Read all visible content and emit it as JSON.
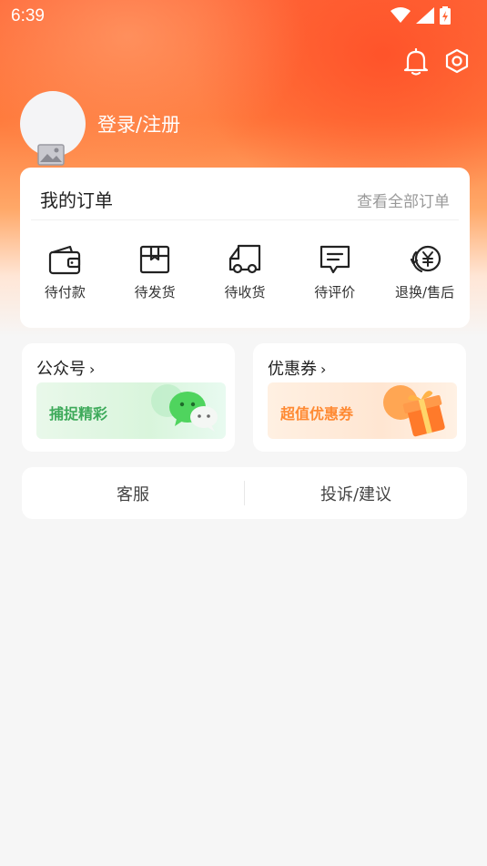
{
  "status_bar": {
    "time": "6:39"
  },
  "user": {
    "login_label": "登录/注册"
  },
  "orders": {
    "title": "我的订单",
    "view_all": "查看全部订单",
    "items": [
      {
        "label": "待付款",
        "icon": "wallet-icon"
      },
      {
        "label": "待发货",
        "icon": "package-icon"
      },
      {
        "label": "待收货",
        "icon": "truck-icon"
      },
      {
        "label": "待评价",
        "icon": "comment-icon"
      },
      {
        "label": "退换/售后",
        "icon": "yen-refund-icon"
      }
    ]
  },
  "promos": {
    "official_account": {
      "title": "公众号",
      "banner_text": "捕捉精彩",
      "icon": "wechat-icon"
    },
    "coupons": {
      "title": "优惠券",
      "banner_text": "超值优惠券",
      "icon": "gift-box-icon"
    }
  },
  "services": {
    "customer_service": "客服",
    "feedback": "投诉/建议"
  },
  "colors": {
    "accent": "#ff6a3a",
    "wechat_green": "#3daa5a",
    "coupon_orange": "#ff8a33"
  }
}
